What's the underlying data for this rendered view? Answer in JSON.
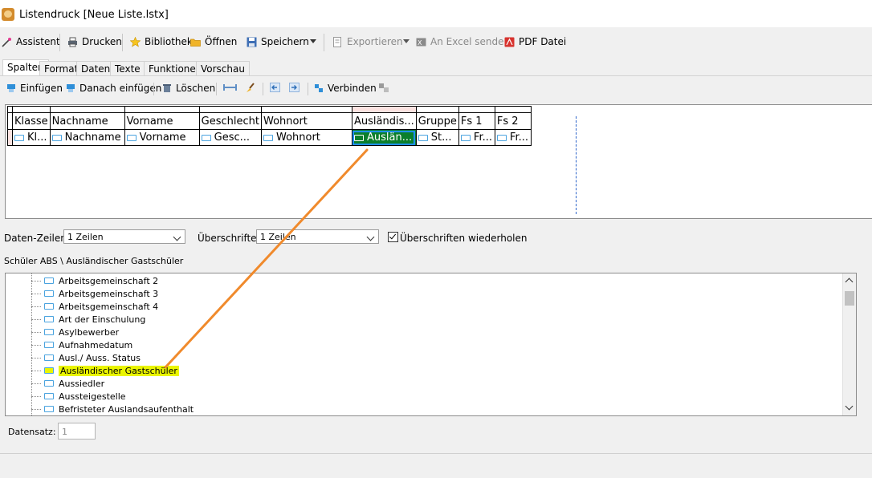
{
  "window": {
    "title": "Listendruck [Neue Liste.lstx]"
  },
  "toolbar": {
    "assistent": "Assistent",
    "drucken": "Drucken",
    "bibliothek": "Bibliothek",
    "oeffnen": "Öffnen",
    "speichern": "Speichern",
    "exportieren": "Exportieren",
    "excel": "An Excel senden",
    "pdf": "PDF Datei"
  },
  "tabs": [
    "Spalten",
    "Format",
    "Daten",
    "Texte",
    "Funktionen",
    "Vorschau"
  ],
  "column_toolbar": {
    "einfuegen": "Einfügen",
    "danach": "Danach einfügen",
    "loeschen": "Löschen",
    "verbinden": "Verbinden"
  },
  "grid": {
    "headers": [
      "Klasse",
      "Nachname",
      "Vorname",
      "Geschlecht",
      "Wohnort",
      "Ausländis...",
      "Gruppe",
      "Fs 1",
      "Fs 2"
    ],
    "fields": [
      "Kl...",
      "Nachname",
      "Vorname",
      "Gesc...",
      "Wohnort",
      "Auslän...",
      "St...",
      "Fr...",
      "Fr..."
    ],
    "selected_index": 5
  },
  "options": {
    "daten_zeilen_label": "Daten-Zeilen:",
    "daten_zeilen_value": "1 Zeilen",
    "ueberschriften_label": "Überschriften:",
    "ueberschriften_value": "1 Zeilen",
    "wiederholen_label": "Überschriften wiederholen",
    "wiederholen_checked": true
  },
  "path": "Schüler ABS \\ Ausländischer Gastschüler",
  "tree": {
    "items": [
      "Arbeitsgemeinschaft 2",
      "Arbeitsgemeinschaft 3",
      "Arbeitsgemeinschaft 4",
      "Art der Einschulung",
      "Asylbewerber",
      "Aufnahmedatum",
      "Ausl./ Auss. Status",
      "Ausländischer Gastschüler",
      "Aussiedler",
      "Aussteigestelle",
      "Befristeter Auslandsaufenthalt"
    ],
    "highlighted_index": 7
  },
  "datensatz": {
    "label": "Datensatz:",
    "value": "1"
  },
  "colors": {
    "selected_cell": "#0b7f2d",
    "highlight": "#eaf500",
    "annotation_arrow": "#f08a2c"
  }
}
